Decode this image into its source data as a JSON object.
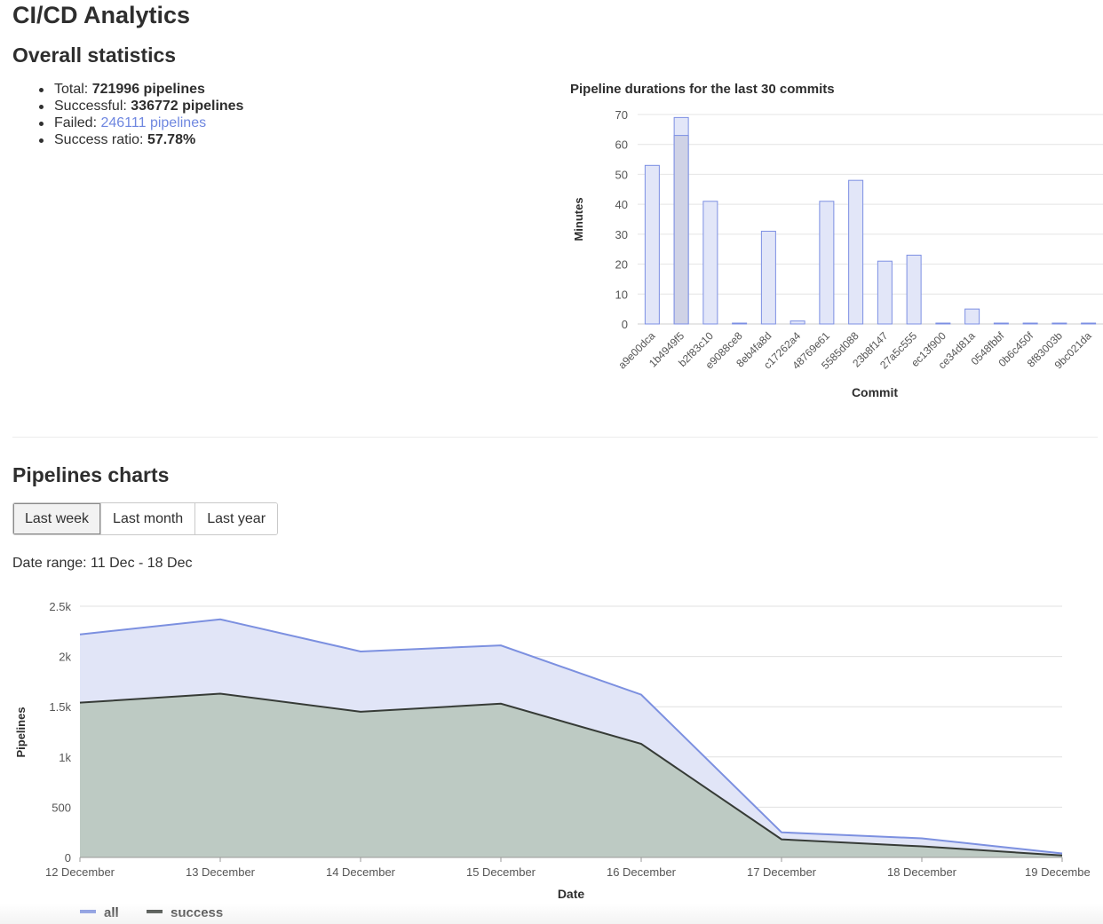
{
  "app": {
    "title": "CI/CD Analytics"
  },
  "overall": {
    "title": "Overall statistics",
    "stats": [
      {
        "label": "Total:",
        "value": "721996 pipelines",
        "style": "bold"
      },
      {
        "label": "Successful:",
        "value": "336772 pipelines",
        "style": "bold"
      },
      {
        "label": "Failed:",
        "value": "246111 pipelines",
        "style": "link"
      },
      {
        "label": "Success ratio:",
        "value": "57.78%",
        "style": "bold"
      }
    ]
  },
  "pipelines": {
    "title": "Pipelines charts",
    "range_buttons": [
      {
        "label": "Last week",
        "active": true
      },
      {
        "label": "Last month",
        "active": false
      },
      {
        "label": "Last year",
        "active": false
      }
    ],
    "date_range": "Date range: 11 Dec - 18 Dec"
  },
  "colors": {
    "bar_fill": "#e2e6f8",
    "bar_stroke": "#7c8fe3",
    "bar_highlight_fill": "#cfd2e6",
    "all_line": "#7c90e0",
    "all_fill": "#e1e5f7",
    "success_line": "#363b36",
    "success_fill": "#bdcac3",
    "link": "#6f87e0"
  },
  "chart_data": [
    {
      "type": "bar",
      "title": "Pipeline durations for the last 30 commits",
      "xlabel": "Commit",
      "ylabel": "Minutes",
      "ylim": [
        0,
        70
      ],
      "yticks": [
        0,
        10,
        20,
        30,
        40,
        50,
        60,
        70
      ],
      "grid": true,
      "categories": [
        "a9e00dca",
        "1b4949f5",
        "b2f83c10",
        "e9088ce8",
        "8eb4fa8d",
        "c17262a4",
        "48769e61",
        "5585d088",
        "23b8f147",
        "27a5c555",
        "ec13f900",
        "ce34d81a",
        "0548fbbf",
        "0b6c450f",
        "8f83003b",
        "9bc021da"
      ],
      "values": [
        53,
        69,
        41,
        0,
        31,
        1,
        41,
        48,
        21,
        23,
        0,
        5,
        0,
        0,
        0,
        0
      ],
      "overlay": {
        "category": "1b4949f5",
        "value": 63
      }
    },
    {
      "type": "area",
      "xlabel": "Date",
      "ylabel": "Pipelines",
      "ylim": [
        0,
        2500
      ],
      "yticks": [
        "0",
        "500",
        "1k",
        "1.5k",
        "2k",
        "2.5k"
      ],
      "ytick_values": [
        0,
        500,
        1000,
        1500,
        2000,
        2500
      ],
      "grid": true,
      "legend_position": "bottom-left",
      "x": [
        "12 December",
        "13 December",
        "14 December",
        "15 December",
        "16 December",
        "17 December",
        "18 December",
        "19 Decembe"
      ],
      "series": [
        {
          "name": "all",
          "values": [
            2220,
            2370,
            2050,
            2110,
            1620,
            250,
            190,
            40
          ]
        },
        {
          "name": "success",
          "values": [
            1540,
            1630,
            1450,
            1530,
            1130,
            180,
            110,
            20
          ]
        }
      ]
    }
  ]
}
